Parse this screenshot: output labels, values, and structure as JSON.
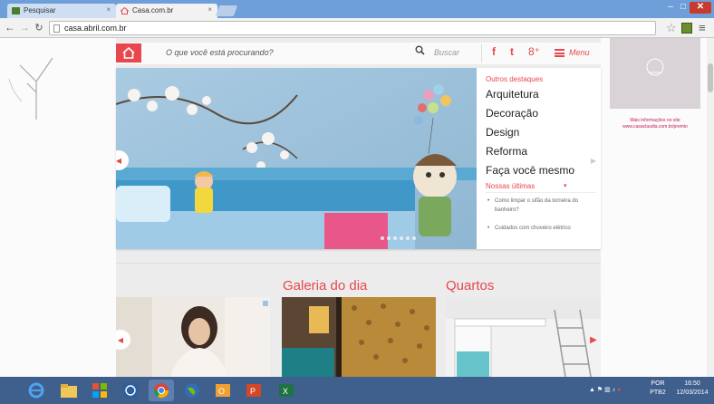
{
  "browser": {
    "tabs": [
      {
        "title": "Pesquisar",
        "active": false
      },
      {
        "title": "Casa.com.br",
        "active": true
      }
    ],
    "address": "casa.abril.com.br",
    "close_glyph": "×",
    "window_min": "–",
    "window_max": "□",
    "window_close": "✕"
  },
  "site": {
    "search_placeholder": "O que você está procurando?",
    "search_button": "Buscar",
    "social": [
      "f",
      "t",
      "8⁺"
    ],
    "menu_label": "Menu",
    "accent_color": "#e8474e"
  },
  "hero": {
    "other_highlights_title": "Outros destaques",
    "highlights": [
      "Arquitetura",
      "Decoração",
      "Design",
      "Reforma",
      "Faça você mesmo"
    ],
    "latest_title": "Nossas últimas",
    "latest_items": [
      "Como limpar o sifão da torneira do banheiro?",
      "Cuidados com chuveiro elétrico"
    ],
    "slide_count": 6
  },
  "sections": {
    "gallery_title": "Galeria do dia",
    "rooms_title": "Quartos"
  },
  "right_ad": {
    "more_info": "Mais informações no site www.casaclaudia.com.br/premio"
  },
  "taskbar": {
    "lang_top": "POR",
    "lang_bottom": "PTB2",
    "time": "16:50",
    "date": "12/03/2014"
  }
}
